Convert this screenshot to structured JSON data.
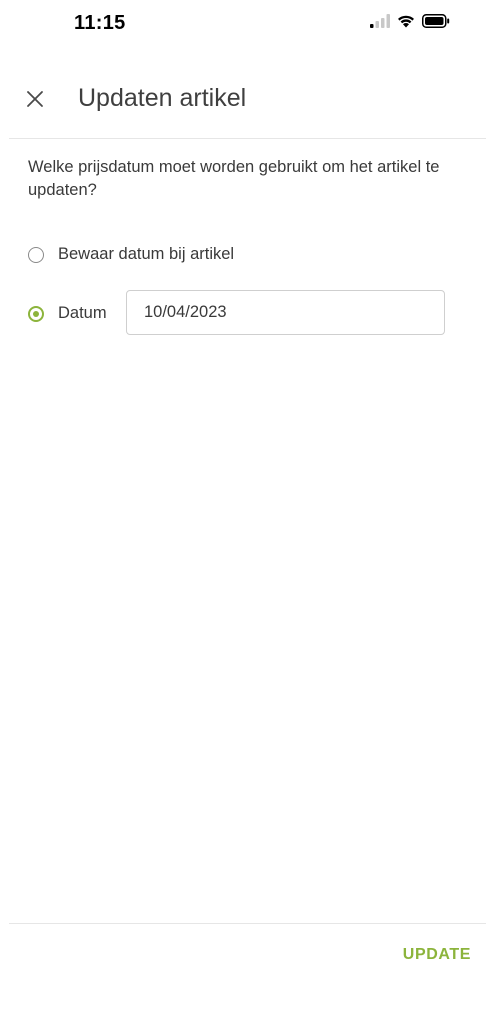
{
  "status_bar": {
    "time": "11:15",
    "icons": [
      "cellular-signal-icon",
      "wifi-icon",
      "battery-icon"
    ]
  },
  "header": {
    "title": "Updaten artikel",
    "close_icon": "close-icon"
  },
  "form": {
    "question": "Welke prijsdatum moet worden gebruikt om het artikel te updaten?",
    "options": [
      {
        "label": "Bewaar datum bij artikel",
        "selected": false
      },
      {
        "label": "Datum",
        "selected": true
      }
    ],
    "date_value": "10/04/2023"
  },
  "footer": {
    "update_label": "UPDATE"
  },
  "colors": {
    "accent": "#8cb43c",
    "text": "#3a3a3a",
    "divider": "#e6e6e6"
  }
}
